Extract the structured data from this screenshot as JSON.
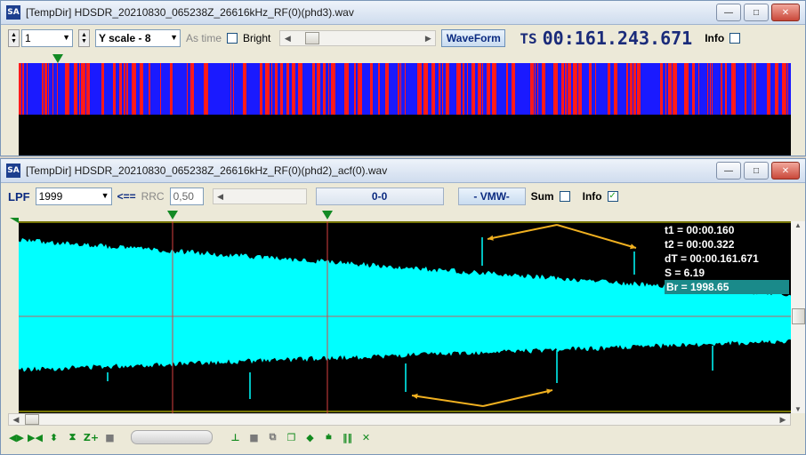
{
  "window1": {
    "title": "[TempDir] HDSDR_20210830_065238Z_26616kHz_RF(0)(phd3).wav",
    "channel_value": "1",
    "yscale_value": "Y scale - 8",
    "as_time_label": "As time",
    "bright_label": "Bright",
    "waveform_label": "WaveForm",
    "ts_label": "TS",
    "ts_value": "00:161.243.671",
    "info_label": "Info",
    "colors": {
      "red": "#ff1a1a",
      "blue": "#1a1aff",
      "bg": "#000000"
    }
  },
  "window2": {
    "title": "[TempDir] HDSDR_20210830_065238Z_26616kHz_RF(0)(phd2)_acf(0).wav",
    "lpf_label": "LPF",
    "lpf_value": "1999",
    "arrow_label": "<==",
    "rrc_label": "RRC",
    "rrc_value": "0,50",
    "range_value": "0-0",
    "vmw_label": "- VMW-",
    "sum_label": "Sum",
    "info_label": "Info",
    "info_checked": "✓",
    "plot": {
      "trace_color": "#00ffff",
      "bg_color": "#000000",
      "readout": {
        "t1": "t1 = 00:00.160",
        "t2": "t2 = 00:00.322",
        "dt": "dT = 00:00.161.671",
        "s": "S = 6.19",
        "br": "Br = 1998.65"
      }
    }
  },
  "icons": [
    "expand-icon",
    "shrink-icon",
    "vertical-expand-icon",
    "vertical-shrink-icon",
    "zoom-plus-icon",
    "stop-icon",
    "scroll-bar",
    "bracket-icon",
    "stop-icon-2",
    "copy-icon",
    "copy-paste-icon",
    "diamond-icon",
    "filter-icon",
    "bars-icon",
    "cross-icon"
  ]
}
